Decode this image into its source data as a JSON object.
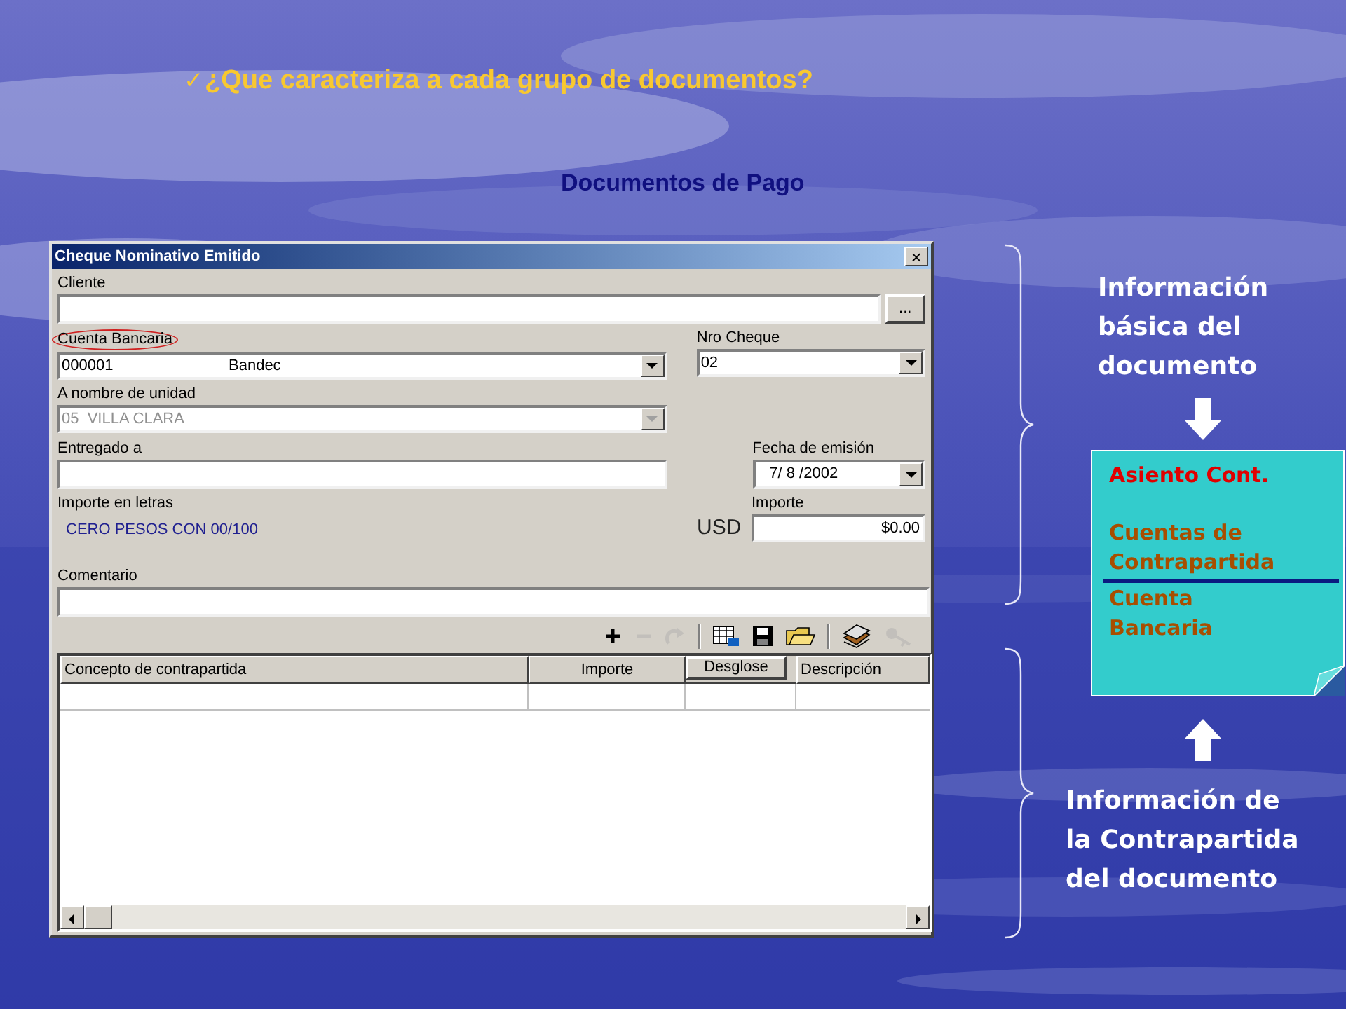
{
  "slide": {
    "bullet": "✓",
    "title": "¿Que caracteriza a cada grupo de documentos?",
    "subtitle": "Documentos de Pago"
  },
  "window": {
    "title": "Cheque Nominativo Emitido",
    "close": "×",
    "cliente": {
      "label": "Cliente",
      "browse": "..."
    },
    "cuenta_bancaria": {
      "label": "Cuenta Bancaria",
      "circled": true,
      "code": "000001",
      "name": "Bandec"
    },
    "nro_cheque": {
      "label": "Nro Cheque",
      "value": "02"
    },
    "a_nombre_de_unidad": {
      "label": "A nombre de unidad",
      "value": "05  VILLA CLARA",
      "disabled": true
    },
    "entregado_a": {
      "label": "Entregado a"
    },
    "fecha_de_emision": {
      "label": "Fecha de emisión",
      "value": "7/ 8 /2002"
    },
    "importe_en_letras": {
      "label": "Importe en letras",
      "value": "CERO PESOS CON 00/100"
    },
    "importe": {
      "label": "Importe",
      "currency": "USD",
      "value": "$0.00"
    },
    "comentario": {
      "label": "Comentario"
    },
    "toolbar": [
      {
        "kind": "add",
        "disabled": false
      },
      {
        "kind": "remove",
        "disabled": true
      },
      {
        "kind": "redo",
        "disabled": true
      },
      {
        "kind": "separator"
      },
      {
        "kind": "grid",
        "disabled": false
      },
      {
        "kind": "save",
        "disabled": false
      },
      {
        "kind": "folder",
        "disabled": false
      },
      {
        "kind": "separator"
      },
      {
        "kind": "stack",
        "disabled": false
      },
      {
        "kind": "key",
        "disabled": true
      }
    ],
    "table": {
      "columns": [
        {
          "label": "Concepto de contrapartida",
          "kind": "header"
        },
        {
          "label": "Importe",
          "kind": "header"
        },
        {
          "label": "Desglose",
          "kind": "button"
        },
        {
          "label": "Descripción",
          "kind": "header"
        }
      ]
    }
  },
  "annotations": {
    "top": "Información\nbásica del\ndocumento",
    "note": {
      "title": "Asiento Cont.",
      "items": [
        "Cuentas de\nContrapartida",
        "Cuenta\nBancaria"
      ]
    },
    "bottom": "Información de\nla Contrapartida\ndel documento"
  }
}
